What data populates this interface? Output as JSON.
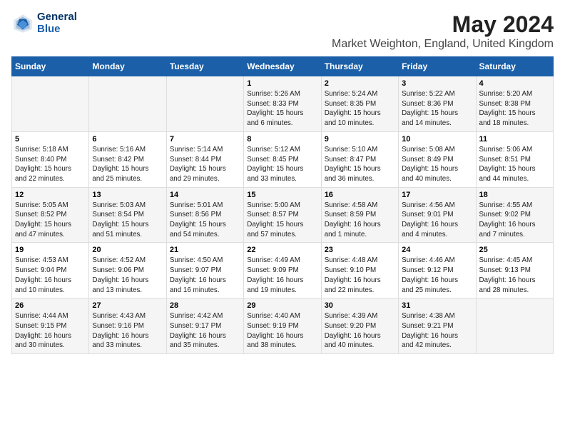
{
  "header": {
    "logo_line1": "General",
    "logo_line2": "Blue",
    "title": "May 2024",
    "subtitle": "Market Weighton, England, United Kingdom"
  },
  "days_of_week": [
    "Sunday",
    "Monday",
    "Tuesday",
    "Wednesday",
    "Thursday",
    "Friday",
    "Saturday"
  ],
  "weeks": [
    {
      "days": [
        {
          "num": "",
          "info": ""
        },
        {
          "num": "",
          "info": ""
        },
        {
          "num": "",
          "info": ""
        },
        {
          "num": "1",
          "info": "Sunrise: 5:26 AM\nSunset: 8:33 PM\nDaylight: 15 hours\nand 6 minutes."
        },
        {
          "num": "2",
          "info": "Sunrise: 5:24 AM\nSunset: 8:35 PM\nDaylight: 15 hours\nand 10 minutes."
        },
        {
          "num": "3",
          "info": "Sunrise: 5:22 AM\nSunset: 8:36 PM\nDaylight: 15 hours\nand 14 minutes."
        },
        {
          "num": "4",
          "info": "Sunrise: 5:20 AM\nSunset: 8:38 PM\nDaylight: 15 hours\nand 18 minutes."
        }
      ]
    },
    {
      "days": [
        {
          "num": "5",
          "info": "Sunrise: 5:18 AM\nSunset: 8:40 PM\nDaylight: 15 hours\nand 22 minutes."
        },
        {
          "num": "6",
          "info": "Sunrise: 5:16 AM\nSunset: 8:42 PM\nDaylight: 15 hours\nand 25 minutes."
        },
        {
          "num": "7",
          "info": "Sunrise: 5:14 AM\nSunset: 8:44 PM\nDaylight: 15 hours\nand 29 minutes."
        },
        {
          "num": "8",
          "info": "Sunrise: 5:12 AM\nSunset: 8:45 PM\nDaylight: 15 hours\nand 33 minutes."
        },
        {
          "num": "9",
          "info": "Sunrise: 5:10 AM\nSunset: 8:47 PM\nDaylight: 15 hours\nand 36 minutes."
        },
        {
          "num": "10",
          "info": "Sunrise: 5:08 AM\nSunset: 8:49 PM\nDaylight: 15 hours\nand 40 minutes."
        },
        {
          "num": "11",
          "info": "Sunrise: 5:06 AM\nSunset: 8:51 PM\nDaylight: 15 hours\nand 44 minutes."
        }
      ]
    },
    {
      "days": [
        {
          "num": "12",
          "info": "Sunrise: 5:05 AM\nSunset: 8:52 PM\nDaylight: 15 hours\nand 47 minutes."
        },
        {
          "num": "13",
          "info": "Sunrise: 5:03 AM\nSunset: 8:54 PM\nDaylight: 15 hours\nand 51 minutes."
        },
        {
          "num": "14",
          "info": "Sunrise: 5:01 AM\nSunset: 8:56 PM\nDaylight: 15 hours\nand 54 minutes."
        },
        {
          "num": "15",
          "info": "Sunrise: 5:00 AM\nSunset: 8:57 PM\nDaylight: 15 hours\nand 57 minutes."
        },
        {
          "num": "16",
          "info": "Sunrise: 4:58 AM\nSunset: 8:59 PM\nDaylight: 16 hours\nand 1 minute."
        },
        {
          "num": "17",
          "info": "Sunrise: 4:56 AM\nSunset: 9:01 PM\nDaylight: 16 hours\nand 4 minutes."
        },
        {
          "num": "18",
          "info": "Sunrise: 4:55 AM\nSunset: 9:02 PM\nDaylight: 16 hours\nand 7 minutes."
        }
      ]
    },
    {
      "days": [
        {
          "num": "19",
          "info": "Sunrise: 4:53 AM\nSunset: 9:04 PM\nDaylight: 16 hours\nand 10 minutes."
        },
        {
          "num": "20",
          "info": "Sunrise: 4:52 AM\nSunset: 9:06 PM\nDaylight: 16 hours\nand 13 minutes."
        },
        {
          "num": "21",
          "info": "Sunrise: 4:50 AM\nSunset: 9:07 PM\nDaylight: 16 hours\nand 16 minutes."
        },
        {
          "num": "22",
          "info": "Sunrise: 4:49 AM\nSunset: 9:09 PM\nDaylight: 16 hours\nand 19 minutes."
        },
        {
          "num": "23",
          "info": "Sunrise: 4:48 AM\nSunset: 9:10 PM\nDaylight: 16 hours\nand 22 minutes."
        },
        {
          "num": "24",
          "info": "Sunrise: 4:46 AM\nSunset: 9:12 PM\nDaylight: 16 hours\nand 25 minutes."
        },
        {
          "num": "25",
          "info": "Sunrise: 4:45 AM\nSunset: 9:13 PM\nDaylight: 16 hours\nand 28 minutes."
        }
      ]
    },
    {
      "days": [
        {
          "num": "26",
          "info": "Sunrise: 4:44 AM\nSunset: 9:15 PM\nDaylight: 16 hours\nand 30 minutes."
        },
        {
          "num": "27",
          "info": "Sunrise: 4:43 AM\nSunset: 9:16 PM\nDaylight: 16 hours\nand 33 minutes."
        },
        {
          "num": "28",
          "info": "Sunrise: 4:42 AM\nSunset: 9:17 PM\nDaylight: 16 hours\nand 35 minutes."
        },
        {
          "num": "29",
          "info": "Sunrise: 4:40 AM\nSunset: 9:19 PM\nDaylight: 16 hours\nand 38 minutes."
        },
        {
          "num": "30",
          "info": "Sunrise: 4:39 AM\nSunset: 9:20 PM\nDaylight: 16 hours\nand 40 minutes."
        },
        {
          "num": "31",
          "info": "Sunrise: 4:38 AM\nSunset: 9:21 PM\nDaylight: 16 hours\nand 42 minutes."
        },
        {
          "num": "",
          "info": ""
        }
      ]
    }
  ]
}
